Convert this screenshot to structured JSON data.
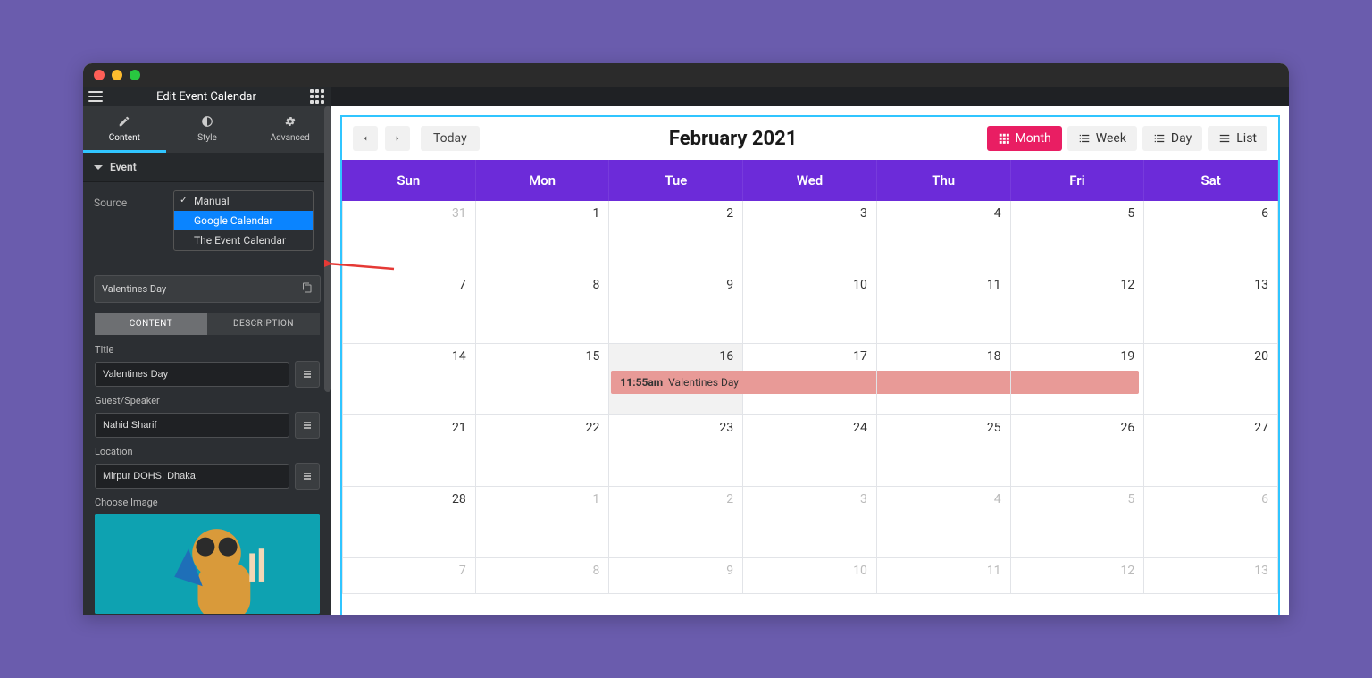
{
  "window": {
    "title": "Edit Event Calendar"
  },
  "tabs": {
    "content": "Content",
    "style": "Style",
    "advanced": "Advanced"
  },
  "section": {
    "event": "Event"
  },
  "source": {
    "label": "Source",
    "options": [
      "Manual",
      "Google Calendar",
      "The Event Calendar"
    ],
    "selected": "Manual",
    "highlighted": "Google Calendar"
  },
  "repeater": {
    "item_label": "Valentines Day"
  },
  "inner_tabs": {
    "content": "CONTENT",
    "description": "DESCRIPTION"
  },
  "fields": {
    "title_label": "Title",
    "title_value": "Valentines Day",
    "guest_label": "Guest/Speaker",
    "guest_value": "Nahid Sharif",
    "location_label": "Location",
    "location_value": "Mirpur DOHS, Dhaka",
    "image_label": "Choose Image"
  },
  "calendar": {
    "title": "February 2021",
    "today_label": "Today",
    "views": {
      "month": "Month",
      "week": "Week",
      "day": "Day",
      "list": "List"
    },
    "active_view": "Month",
    "day_names": [
      "Sun",
      "Mon",
      "Tue",
      "Wed",
      "Thu",
      "Fri",
      "Sat"
    ],
    "weeks": [
      [
        {
          "n": 31,
          "other": true
        },
        {
          "n": 1
        },
        {
          "n": 2
        },
        {
          "n": 3
        },
        {
          "n": 4
        },
        {
          "n": 5
        },
        {
          "n": 6
        }
      ],
      [
        {
          "n": 7
        },
        {
          "n": 8
        },
        {
          "n": 9
        },
        {
          "n": 10
        },
        {
          "n": 11
        },
        {
          "n": 12
        },
        {
          "n": 13
        }
      ],
      [
        {
          "n": 14
        },
        {
          "n": 15
        },
        {
          "n": 16,
          "today": true
        },
        {
          "n": 17
        },
        {
          "n": 18
        },
        {
          "n": 19
        },
        {
          "n": 20
        }
      ],
      [
        {
          "n": 21
        },
        {
          "n": 22
        },
        {
          "n": 23
        },
        {
          "n": 24
        },
        {
          "n": 25
        },
        {
          "n": 26
        },
        {
          "n": 27
        }
      ],
      [
        {
          "n": 28
        },
        {
          "n": 1,
          "other": true
        },
        {
          "n": 2,
          "other": true
        },
        {
          "n": 3,
          "other": true
        },
        {
          "n": 4,
          "other": true
        },
        {
          "n": 5,
          "other": true
        },
        {
          "n": 6,
          "other": true
        }
      ],
      [
        {
          "n": 7,
          "other": true
        },
        {
          "n": 8,
          "other": true
        },
        {
          "n": 9,
          "other": true
        },
        {
          "n": 10,
          "other": true
        },
        {
          "n": 11,
          "other": true
        },
        {
          "n": 12,
          "other": true
        },
        {
          "n": 13,
          "other": true
        }
      ]
    ],
    "event": {
      "time": "11:55am",
      "title": "Valentines Day"
    }
  },
  "colors": {
    "accent": "#6c2bd9",
    "pink": "#e91e63",
    "event": "#e89a97",
    "frame": "#30c5ff"
  }
}
